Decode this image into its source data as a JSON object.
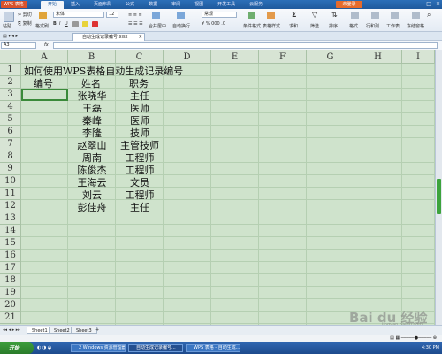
{
  "titlebar": {
    "app_button": "WPS 表格",
    "tabs": [
      "开始",
      "插入",
      "页面布局",
      "公式",
      "数据",
      "审阅",
      "视图",
      "开发工具",
      "云服务"
    ],
    "active_tab": 0,
    "login": "未登录"
  },
  "ribbon": {
    "paste": "粘贴",
    "cut": "剪切",
    "copy": "复制",
    "format_painter": "格式刷",
    "font_name": "宋体",
    "font_size": "12",
    "merge_center": "合并居中",
    "auto_wrap": "自动换行",
    "number_format": "常规",
    "table_style": "表格样式",
    "sum": "求和",
    "filter": "筛选",
    "sort": "排序",
    "format": "格式",
    "row_col": "行和列",
    "worksheet": "工作表",
    "freeze": "冻结窗格",
    "find_select": "查找选择",
    "cond_format": "条件格式",
    "cell_style": "单元格样式"
  },
  "doc_tab": {
    "label": "自动生成记录编号.xlsx",
    "close": "×"
  },
  "formula_bar": {
    "cell_ref": "A3",
    "fx": "fx",
    "value": ""
  },
  "grid": {
    "columns": [
      "A",
      "B",
      "C",
      "D",
      "E",
      "F",
      "G",
      "H",
      "I"
    ],
    "rows": [
      "1",
      "2",
      "3",
      "4",
      "5",
      "6",
      "7",
      "8",
      "9",
      "10",
      "11",
      "12",
      "13",
      "14",
      "15",
      "16",
      "17",
      "18",
      "19",
      "20",
      "21"
    ],
    "title": "如何使用WPS表格自动生成记录编号",
    "header": {
      "number": "编号",
      "name": "姓名",
      "position": "职务"
    },
    "names": [
      "张晓华",
      "王磊",
      "秦峰",
      "李隆",
      "赵翠山",
      "周南",
      "陈俊杰",
      "王海云",
      "刘云",
      "彭佳舟"
    ],
    "positions": [
      "主任",
      "医师",
      "医师",
      "技师",
      "主管技师",
      "工程师",
      "工程师",
      "文员",
      "工程师",
      "主任"
    ]
  },
  "sheets": {
    "tabs": [
      "Sheet1",
      "Sheet2",
      "Sheet3"
    ],
    "add": "+"
  },
  "watermark": {
    "text": "Bai du 经验",
    "sub": "jingyan.baidu.com"
  },
  "taskbar": {
    "start": "开始",
    "items": [
      "2 Windows 资源管理器",
      "自动生成记录编号...",
      "WPS 表格 - 自动生成..."
    ],
    "active_item": 1,
    "clock": "4:30 PM"
  },
  "colors": {
    "sheet_bg": "#cfe3cc",
    "title_bar": "#2c6fb8",
    "selection": "#3a8a3a",
    "start_button": "#2a7b2a"
  }
}
